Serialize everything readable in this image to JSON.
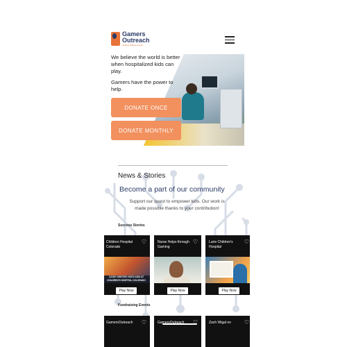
{
  "header": {
    "logo_name_line1": "Gamers",
    "logo_name_line2": "Outreach",
    "logo_tagline": "Healing Without Limits",
    "menu_icon": "hamburger-icon"
  },
  "hero": {
    "text1": "We believe the world is better when hospitalized kids can play.",
    "text2": "Gamers have the power to help.",
    "donate_once": "DONATE ONCE",
    "donate_monthly": "DONATE MONTHLY"
  },
  "news": {
    "section_title": "News & Stories",
    "headline": "Become a part of our community",
    "support_text": "Support our quest to empower kids. Our work is made possible thanks to your contribution!",
    "success_label": "Success Stories",
    "fundraising_label": "Fundraising Events"
  },
  "success_cards": [
    {
      "title": "Children Hospital Colorado",
      "banner": "CASEY KREITER VISITS KIDS AT CHILDREN'S HOSPITAL COLORADO",
      "play": "Play Now"
    },
    {
      "title": "Nurse Helps through Gaming",
      "play": "Play Now"
    },
    {
      "title": "Lurie Children's Hospital",
      "play": "Play Now"
    }
  ],
  "fundraising_cards": [
    {
      "title": "GamersOutreach"
    },
    {
      "title": "GamersOutreach"
    },
    {
      "title": "Zach Wigal on"
    }
  ],
  "colors": {
    "accent": "#f2905e",
    "brand_navy": "#2b3a67",
    "brand_orange": "#e8743b"
  }
}
